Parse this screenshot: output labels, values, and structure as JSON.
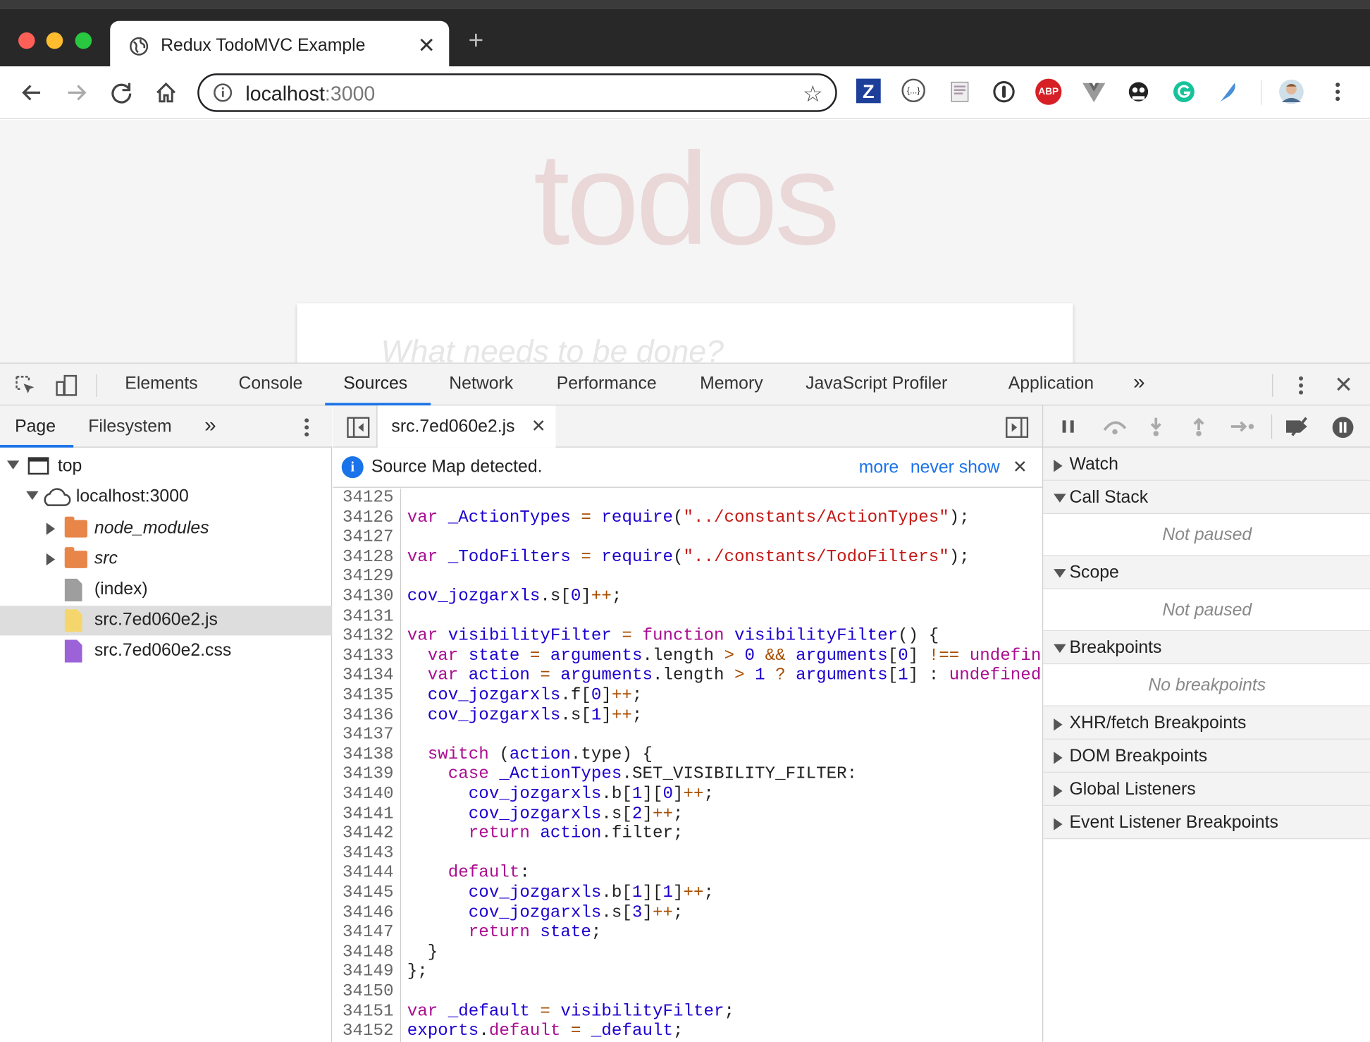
{
  "browser": {
    "tab_title": "Redux TodoMVC Example",
    "tab_close": "✕",
    "new_tab": "+",
    "url_host": "localhost",
    "url_port": ":3000",
    "star_icon": "☆",
    "extensions": [
      "Z",
      "{...}",
      "ABP"
    ]
  },
  "page": {
    "heading": "todos",
    "input_placeholder": "What needs to be done?"
  },
  "devtools": {
    "tabs": [
      "Elements",
      "Console",
      "Sources",
      "Network",
      "Performance",
      "Memory",
      "JavaScript Profiler",
      "Application"
    ],
    "active_tab": "Sources",
    "more_tabs": "»",
    "close": "✕",
    "navigator": {
      "tabs": [
        "Page",
        "Filesystem"
      ],
      "more": "»",
      "tree": [
        {
          "label": "top",
          "icon": "frame-icon"
        },
        {
          "label": "localhost:3000",
          "icon": "cloud-icon"
        },
        {
          "label": "node_modules",
          "icon": "folder-icon"
        },
        {
          "label": "src",
          "icon": "folder-icon"
        },
        {
          "label": "(index)",
          "icon": "file-icon"
        },
        {
          "label": "src.7ed060e2.js",
          "icon": "js-file-icon"
        },
        {
          "label": "src.7ed060e2.css",
          "icon": "css-file-icon"
        }
      ],
      "selected": "src.7ed060e2.js"
    },
    "editor": {
      "file_tab": "src.7ed060e2.js",
      "file_tab_close": "✕",
      "infobar": {
        "message": "Source Map detected.",
        "more": "more",
        "never_show": "never show",
        "close": "✕"
      },
      "line_numbers": [
        "34125",
        "34126",
        "34127",
        "34128",
        "34129",
        "34130",
        "34131",
        "34132",
        "34133",
        "34134",
        "34135",
        "34136",
        "34137",
        "34138",
        "34139",
        "34140",
        "34141",
        "34142",
        "34143",
        "34144",
        "34145",
        "34146",
        "34147",
        "34148",
        "34149",
        "34150",
        "34151",
        "34152"
      ],
      "code_lines": [
        "",
        "var _ActionTypes = require(\"../constants/ActionTypes\");",
        "",
        "var _TodoFilters = require(\"../constants/TodoFilters\");",
        "",
        "cov_jozgarxls.s[0]++;",
        "",
        "var visibilityFilter = function visibilityFilter() {",
        "  var state = arguments.length > 0 && arguments[0] !== undefin",
        "  var action = arguments.length > 1 ? arguments[1] : undefined",
        "  cov_jozgarxls.f[0]++;",
        "  cov_jozgarxls.s[1]++;",
        "",
        "  switch (action.type) {",
        "    case _ActionTypes.SET_VISIBILITY_FILTER:",
        "      cov_jozgarxls.b[1][0]++;",
        "      cov_jozgarxls.s[2]++;",
        "      return action.filter;",
        "",
        "    default:",
        "      cov_jozgarxls.b[1][1]++;",
        "      cov_jozgarxls.s[3]++;",
        "      return state;",
        "  }",
        "};",
        "",
        "var _default = visibilityFilter;",
        "exports.default = _default;"
      ]
    },
    "debugger": {
      "sections": [
        {
          "label": "Watch",
          "expanded": false
        },
        {
          "label": "Call Stack",
          "expanded": true,
          "empty": "Not paused"
        },
        {
          "label": "Scope",
          "expanded": true,
          "empty": "Not paused"
        },
        {
          "label": "Breakpoints",
          "expanded": true,
          "empty": "No breakpoints"
        },
        {
          "label": "XHR/fetch Breakpoints",
          "expanded": false
        },
        {
          "label": "DOM Breakpoints",
          "expanded": false
        },
        {
          "label": "Global Listeners",
          "expanded": false
        },
        {
          "label": "Event Listener Breakpoints",
          "expanded": false
        }
      ]
    }
  }
}
